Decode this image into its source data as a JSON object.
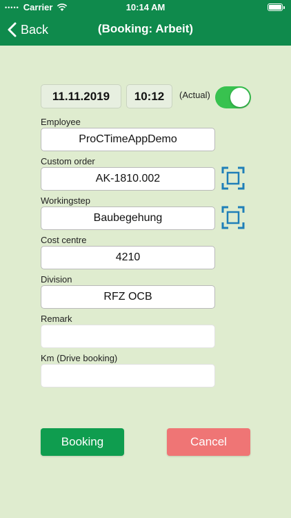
{
  "status_bar": {
    "carrier": "Carrier",
    "time": "10:14 AM",
    "signal": "•••••"
  },
  "nav": {
    "back_label": "Back",
    "title": "(Booking: Arbeit)"
  },
  "datetime": {
    "date": "11.11.2019",
    "time": "10:12",
    "actual_label": "(Actual)",
    "actual_on": true
  },
  "fields": {
    "employee": {
      "label": "Employee",
      "value": "ProCTimeAppDemo"
    },
    "custom_order": {
      "label": "Custom order",
      "value": "AK-1810.002"
    },
    "workingstep": {
      "label": "Workingstep",
      "value": "Baubegehung"
    },
    "cost_centre": {
      "label": "Cost centre",
      "value": "4210"
    },
    "division": {
      "label": "Division",
      "value": "RFZ OCB"
    },
    "remark": {
      "label": "Remark",
      "value": ""
    },
    "km": {
      "label": "Km (Drive booking)",
      "value": ""
    }
  },
  "actions": {
    "booking": "Booking",
    "cancel": "Cancel"
  },
  "colors": {
    "header": "#0f8a4c",
    "background": "#dfeccf",
    "toggle_on": "#38c24f",
    "booking_button": "#0f9d4f",
    "cancel_button": "#ef7575",
    "scan_icon": "#1f7fb8"
  },
  "icons": {
    "back": "chevron-left-icon",
    "scan": "scan-frame-icon",
    "wifi": "wifi-icon",
    "battery": "battery-icon"
  }
}
